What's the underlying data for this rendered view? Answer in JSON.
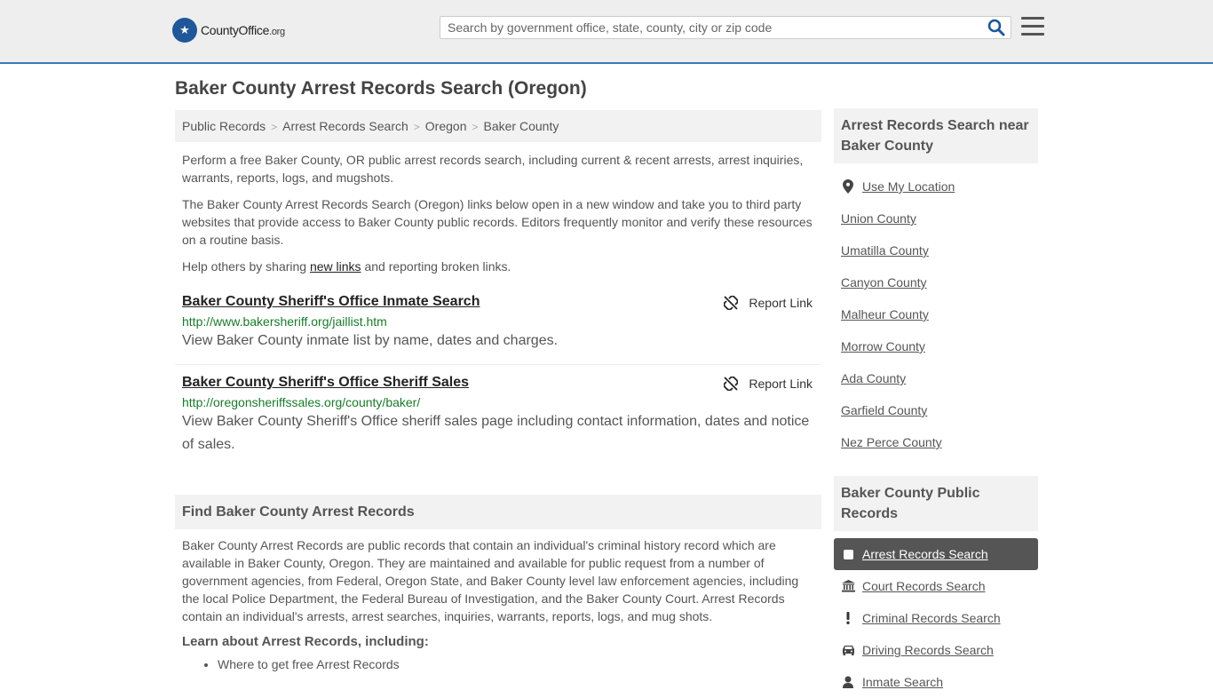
{
  "header": {
    "logo_main": "CountyOffice",
    "logo_org": ".org",
    "search_placeholder": "Search by government office, state, county, city or zip code"
  },
  "page_title": "Baker County Arrest Records Search (Oregon)",
  "breadcrumb": [
    "Public Records",
    "Arrest Records Search",
    "Oregon",
    "Baker County"
  ],
  "intro": {
    "p1": "Perform a free Baker County, OR public arrest records search, including current & recent arrests, arrest inquiries, warrants, reports, logs, and mugshots.",
    "p2": "The Baker County Arrest Records Search (Oregon) links below open in a new window and take you to third party websites that provide access to Baker County public records. Editors frequently monitor and verify these resources on a routine basis.",
    "p3_before": "Help others by sharing ",
    "p3_link": "new links",
    "p3_after": " and reporting broken links."
  },
  "results": [
    {
      "title": "Baker County Sheriff's Office Inmate Search",
      "url": "http://www.bakersheriff.org/jaillist.htm",
      "desc": "View Baker County inmate list by name, dates and charges.",
      "report": "Report Link"
    },
    {
      "title": "Baker County Sheriff's Office Sheriff Sales",
      "url": "http://oregonsheriffssales.org/county/baker/",
      "desc": "View Baker County Sheriff's Office sheriff sales page including contact information, dates and notice of sales.",
      "report": "Report Link"
    }
  ],
  "find": {
    "heading": "Find Baker County Arrest Records",
    "body": "Baker County Arrest Records are public records that contain an individual's criminal history record which are available in Baker County, Oregon. They are maintained and available for public request from a number of government agencies, from Federal, Oregon State, and Baker County level law enforcement agencies, including the local Police Department, the Federal Bureau of Investigation, and the Baker County Court. Arrest Records contain an individual's arrests, arrest searches, inquiries, warrants, reports, logs, and mug shots.",
    "learn": "Learn about Arrest Records, including:",
    "items": [
      "Where to get free Arrest Records"
    ]
  },
  "sidebar": {
    "nearby_heading": "Arrest Records Search near Baker County",
    "use_location": "Use My Location",
    "nearby": [
      "Union County",
      "Umatilla County",
      "Canyon County",
      "Malheur County",
      "Morrow County",
      "Ada County",
      "Garfield County",
      "Nez Perce County"
    ],
    "public_heading": "Baker County Public Records",
    "public": [
      {
        "label": "Arrest Records Search",
        "icon": "checkbox-icon",
        "active": true
      },
      {
        "label": "Court Records Search",
        "icon": "courthouse-icon",
        "active": false
      },
      {
        "label": "Criminal Records Search",
        "icon": "exclamation-icon",
        "active": false
      },
      {
        "label": "Driving Records Search",
        "icon": "car-icon",
        "active": false
      },
      {
        "label": "Inmate Search",
        "icon": "inmate-icon",
        "active": false
      }
    ]
  },
  "colors": {
    "brand_blue": "#1f5799",
    "header_border": "#3a79b8",
    "url_green": "#1a7a2a",
    "active_bg": "#555555"
  }
}
